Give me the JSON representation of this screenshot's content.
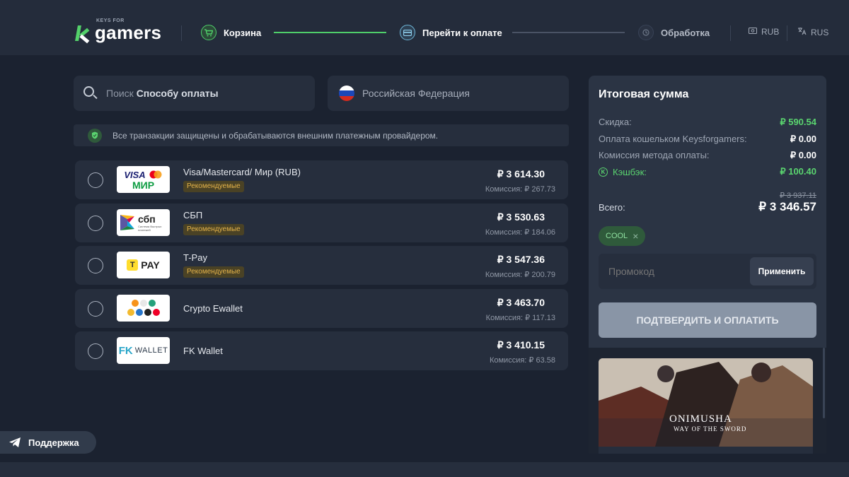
{
  "header": {
    "logo_small": "KEYS FOR",
    "logo_big": "gamers",
    "steps": [
      {
        "label": "Корзина",
        "icon": "cart-icon"
      },
      {
        "label": "Перейти к оплате",
        "icon": "card-icon"
      },
      {
        "label": "Обработка",
        "icon": "processing-icon"
      }
    ],
    "currency": "RUB",
    "language": "RUS",
    "accent_color": "#4fcf6a"
  },
  "search": {
    "placeholder_prefix": "Поиск ",
    "placeholder_bold": "Способу оплаты"
  },
  "country": {
    "label": "Российская Федерация"
  },
  "secure_notice": "Все транзакции защищены и обрабатываются внешним платежным провайдером.",
  "payment_methods": [
    {
      "name": "Visa/Mastercard/ Мир (RUB)",
      "badge": "Рекомендуемые",
      "price": "₽ 3 614.30",
      "fee": "Комиссия: ₽ 267.73",
      "logo_top": "VISA",
      "logo_bottom": "МИР"
    },
    {
      "name": "СБП",
      "badge": "Рекомендуемые",
      "price": "₽ 3 530.63",
      "fee": "Комиссия: ₽ 184.06",
      "logo_text": "сбп",
      "logo_sub": "Система быстрых платежей"
    },
    {
      "name": "T-Pay",
      "badge": "Рекомендуемые",
      "price": "₽ 3 547.36",
      "fee": "Комиссия: ₽ 200.79",
      "logo_text": "PAY",
      "logo_mark": "T"
    },
    {
      "name": "Crypto Ewallet",
      "badge": "",
      "price": "₽ 3 463.70",
      "fee": "Комиссия: ₽ 117.13"
    },
    {
      "name": "FK Wallet",
      "badge": "",
      "price": "₽ 3 410.15",
      "fee": "Комиссия: ₽ 63.58",
      "logo_text": "WALLET",
      "logo_mark": "FK"
    }
  ],
  "summary": {
    "title": "Итоговая сумма",
    "rows": [
      {
        "label": "Скидка:",
        "value": "₽ 590.54"
      },
      {
        "label": "Оплата кошельком Keysforgamers:",
        "value": "₽ 0.00"
      },
      {
        "label": "Комиссия метода оплаты:",
        "value": "₽ 0.00"
      },
      {
        "label": "Кэшбэк:",
        "value": "₽ 100.40"
      }
    ],
    "old_total": "₽ 3 937.11",
    "total_label": "Всего:",
    "total_value": "₽ 3 346.57",
    "coupon": "COOL",
    "promo_placeholder": "Промокод",
    "apply_label": "Применить",
    "confirm_label": "ПОДТВЕРДИТЬ И ОПЛАТИТЬ"
  },
  "game": {
    "title": "ONIMUSHA",
    "subtitle": "WAY OF THE SWORD"
  },
  "support_label": "Поддержка"
}
